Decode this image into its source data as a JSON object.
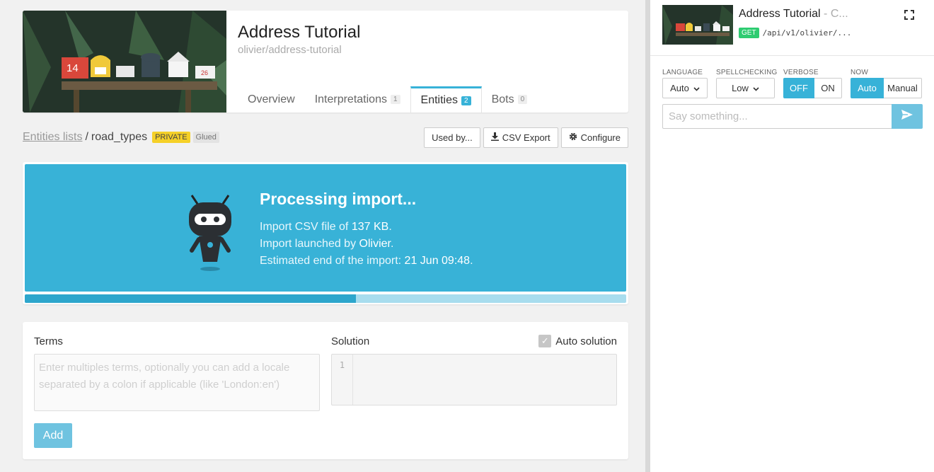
{
  "header": {
    "title": "Address Tutorial",
    "slug": "olivier/address-tutorial",
    "tabs": [
      {
        "label": "Overview",
        "count": ""
      },
      {
        "label": "Interpretations",
        "count": "1"
      },
      {
        "label": "Entities",
        "count": "2"
      },
      {
        "label": "Bots",
        "count": "0"
      }
    ]
  },
  "breadcrumb": {
    "parent": "Entities lists",
    "sep": "/",
    "current": "road_types",
    "badge_private": "PRIVATE",
    "badge_glued": "Glued"
  },
  "actions": {
    "used_by": "Used by...",
    "csv_export": "CSV Export",
    "configure": "Configure"
  },
  "processing": {
    "title": "Processing import...",
    "line1_prefix": "Import CSV file of ",
    "line1_value": "137 KB",
    "line1_suffix": ".",
    "line2_prefix": "Import launched by ",
    "line2_value": "Olivier",
    "line2_suffix": ".",
    "line3_prefix": "Estimated end of the import: ",
    "line3_value": "21 Jun 09:48",
    "line3_suffix": ".",
    "progress": 0.55
  },
  "form": {
    "terms_label": "Terms",
    "terms_placeholder": "Enter multiples terms, optionally you can add a locale separated by a colon if applicable (like 'London:en')",
    "solution_label": "Solution",
    "line_number": "1",
    "auto_solution_label": "Auto solution",
    "add_label": "Add"
  },
  "panel": {
    "title": "Address Tutorial",
    "title_suffix": " - C...",
    "method": "GET",
    "path": "/api/v1/olivier/...",
    "language_label": "LANGUAGE",
    "language_value": "Auto",
    "spellcheck_label": "SPELLCHECKING",
    "spellcheck_value": "Low",
    "verbose_label": "VERBOSE",
    "verbose_off": "OFF",
    "verbose_on": "ON",
    "now_label": "NOW",
    "now_auto": "Auto",
    "now_manual": "Manual",
    "say_placeholder": "Say something..."
  },
  "colors": {
    "accent": "#37b2d8",
    "badge_private": "#f5d028",
    "get": "#2ecc71"
  }
}
